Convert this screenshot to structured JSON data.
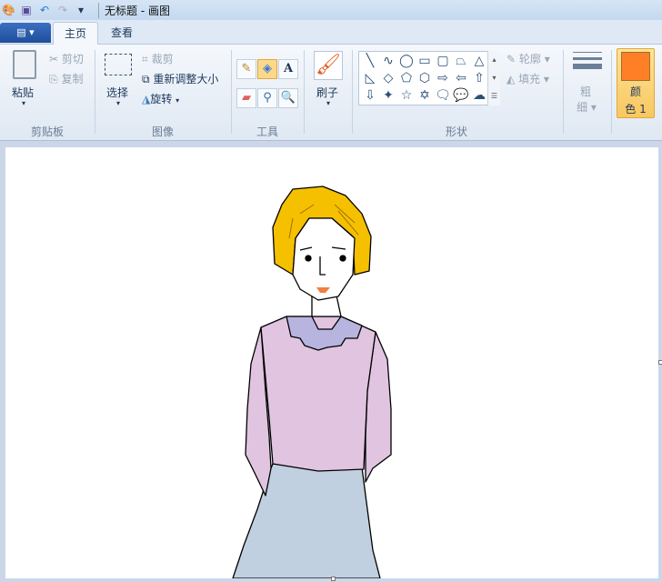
{
  "titlebar": {
    "title": "无标题 - 画图",
    "icons": [
      "paint-app-icon",
      "save-icon",
      "undo-icon",
      "redo-icon",
      "customize-dropdown-icon"
    ]
  },
  "tabs": {
    "file": "▤ ▾",
    "home": "主页",
    "view": "查看"
  },
  "clipboard": {
    "paste": "粘贴",
    "cut": "剪切",
    "copy": "复制",
    "label": "剪贴板"
  },
  "image": {
    "select": "选择",
    "crop": "裁剪",
    "resize": "重新调整大小",
    "rotate": "旋转",
    "label": "图像"
  },
  "tools": {
    "label": "工具",
    "text_tool": "A"
  },
  "brushes": {
    "label": "刷子"
  },
  "shapes": {
    "label": "形状",
    "outline": "轮廓",
    "fill": "填充",
    "gallery": [
      "╲",
      "∿",
      "◯",
      "▭",
      "▢",
      "⏢",
      "△",
      "◺",
      "◇",
      "⬠",
      "⬡",
      "⇨",
      "⇦",
      "⇧",
      "⇩",
      "✦",
      "☆",
      "✡",
      "🗨",
      "💬",
      "☁"
    ]
  },
  "size": {
    "label1": "粗",
    "label2": "细"
  },
  "color1": {
    "label1": "颜",
    "label2": "色 1",
    "color": "#ff7f27"
  }
}
